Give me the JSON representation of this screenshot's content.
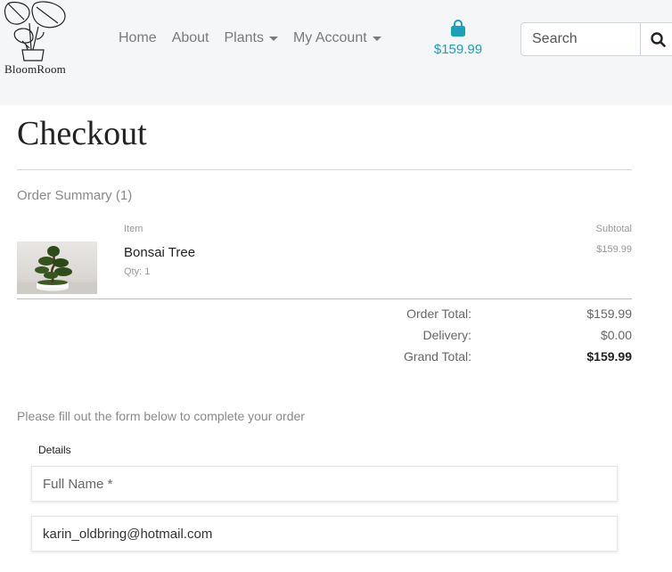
{
  "brand": {
    "name": "BloomRoom"
  },
  "nav": {
    "items": [
      {
        "label": "Home",
        "dropdown": false
      },
      {
        "label": "About",
        "dropdown": false
      },
      {
        "label": "Plants",
        "dropdown": true
      },
      {
        "label": "My Account",
        "dropdown": true
      }
    ]
  },
  "bag": {
    "icon": "shopping-bag-icon",
    "total": "$159.99",
    "color": "#17a2b8"
  },
  "search": {
    "placeholder": "Search",
    "icon": "search-icon"
  },
  "page": {
    "title": "Checkout"
  },
  "summary": {
    "title": "Order Summary (1)",
    "col_item": "Item",
    "col_subtotal": "Subtotal",
    "items": [
      {
        "name": "Bonsai Tree",
        "qty": "Qty: 1",
        "subtotal": "$159.99"
      }
    ]
  },
  "totals": {
    "order_label": "Order Total:",
    "order_value": "$159.99",
    "delivery_label": "Delivery:",
    "delivery_value": "$0.00",
    "grand_label": "Grand Total:",
    "grand_value": "$159.99"
  },
  "form": {
    "intro": "Please fill out the form below to complete your order",
    "legend": "Details",
    "full_name": {
      "placeholder": "Full Name *",
      "value": ""
    },
    "email": {
      "value": "karin_oldbring@hotmail.com"
    }
  }
}
